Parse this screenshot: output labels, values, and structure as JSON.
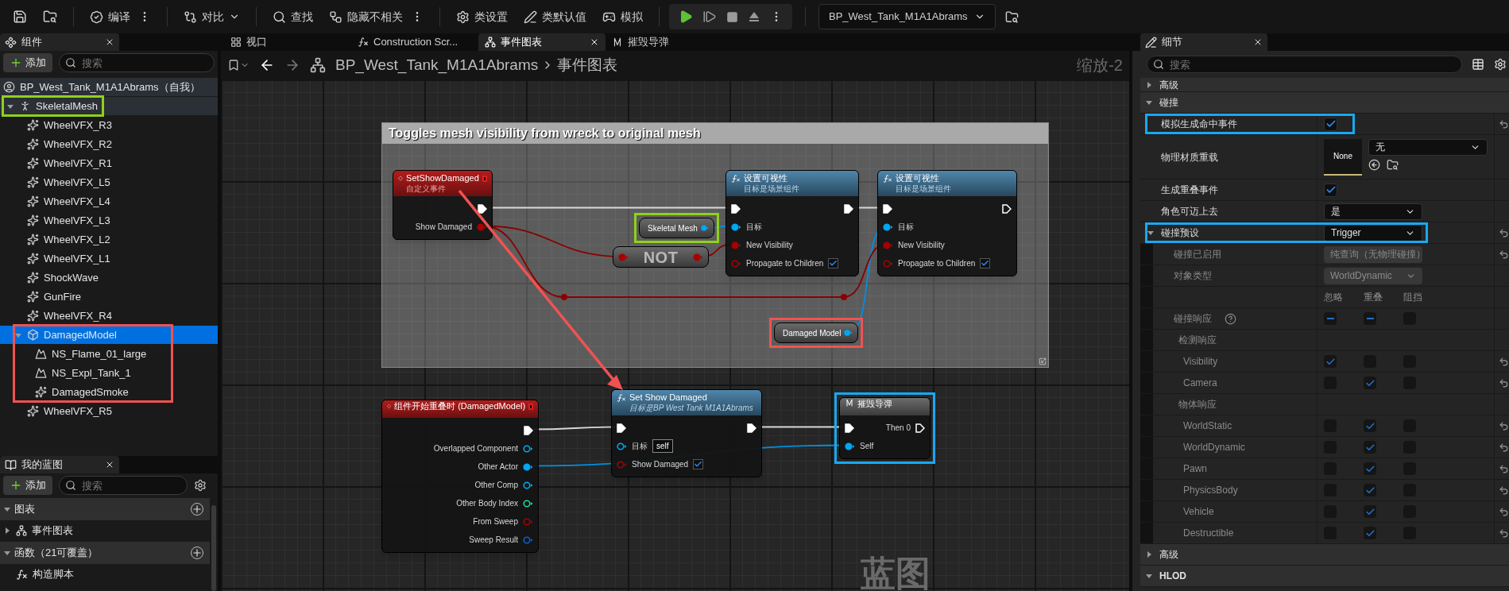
{
  "toolbar": {
    "buttons": [
      {
        "label": "编译",
        "kind": "menu",
        "divider_before": true
      },
      {
        "label": "对比",
        "kind": "dropdown",
        "divider_before": true
      },
      {
        "label": "查找",
        "kind": "plain",
        "divider_before": true
      },
      {
        "label": "隐藏不相关",
        "kind": "menu",
        "divider_before": false
      },
      {
        "label": "类设置",
        "kind": "plain",
        "divider_before": true
      },
      {
        "label": "类默认值",
        "kind": "plain",
        "divider_before": false
      },
      {
        "label": "模拟",
        "kind": "plain",
        "divider_before": false
      }
    ],
    "blueprint_selector": "BP_West_Tank_M1A1Abrams"
  },
  "components": {
    "title": "组件",
    "add_label": "添加",
    "search_placeholder": "搜索",
    "tree": [
      {
        "label": "BP_West_Tank_M1A1Abrams（自我）",
        "kind": "actor",
        "selected": false,
        "children": [
          {
            "label": "SkeletalMesh",
            "kind": "skeletal",
            "selected": false,
            "expanded": true,
            "highlight": {
              "color": "#8fd11b"
            },
            "children": [
              {
                "label": "WheelVFX_R3",
                "kind": "vfx",
                "selected": false
              },
              {
                "label": "WheelVFX_R2",
                "kind": "vfx",
                "selected": false
              },
              {
                "label": "WheelVFX_R1",
                "kind": "vfx",
                "selected": false
              },
              {
                "label": "WheelVFX_L5",
                "kind": "vfx",
                "selected": false
              },
              {
                "label": "WheelVFX_L4",
                "kind": "vfx",
                "selected": false
              },
              {
                "label": "WheelVFX_L3",
                "kind": "vfx",
                "selected": false
              },
              {
                "label": "WheelVFX_L2",
                "kind": "vfx",
                "selected": false
              },
              {
                "label": "WheelVFX_L1",
                "kind": "vfx",
                "selected": false
              },
              {
                "label": "ShockWave",
                "kind": "vfx",
                "selected": false
              },
              {
                "label": "GunFire",
                "kind": "vfx",
                "selected": false
              },
              {
                "label": "WheelVFX_R4",
                "kind": "vfx",
                "selected": false
              },
              {
                "label": "DamagedModel",
                "kind": "mesh",
                "selected": true,
                "expanded": true,
                "group_highlight": {
                  "color": "#f05252"
                },
                "children": [
                  {
                    "label": "NS_Flame_01_large",
                    "kind": "emitter",
                    "selected": false
                  },
                  {
                    "label": "NS_Expl_Tank_1",
                    "kind": "emitter",
                    "selected": false
                  },
                  {
                    "label": "DamagedSmoke",
                    "kind": "vfx",
                    "selected": false
                  }
                ]
              },
              {
                "label": "WheelVFX_R5",
                "kind": "vfx",
                "selected": false
              }
            ]
          }
        ]
      }
    ]
  },
  "my_blueprint": {
    "title": "我的蓝图",
    "add_label": "添加",
    "search_placeholder": "搜索",
    "sections": [
      {
        "label": "图表",
        "expanded": true,
        "items": [
          {
            "label": "事件图表",
            "kind": "graph",
            "expanded": false
          }
        ]
      },
      {
        "label": "函数（21可覆盖）",
        "expanded": true,
        "items": [
          {
            "label": "构造脚本",
            "kind": "function"
          }
        ]
      }
    ]
  },
  "editor_tabs": [
    {
      "label": "视口",
      "kind": "viewport",
      "selected": false
    },
    {
      "label": "Construction Scr...",
      "kind": "function",
      "selected": false
    },
    {
      "label": "事件图表",
      "kind": "graph",
      "selected": true
    },
    {
      "label": "摧毁导弹",
      "kind": "macro",
      "selected": false
    }
  ],
  "breadcrumb": {
    "blueprint": "BP_West_Tank_M1A1Abrams",
    "graph": "事件图表"
  },
  "graph": {
    "comment": "Toggles mesh visibility from wreck to original mesh",
    "zoom_label": "缩放-2",
    "watermark": "蓝图",
    "nodes": [
      {
        "kind": "event",
        "title": "SetShowDamaged",
        "subtitle": "自定义事件",
        "rows": [
          {
            "right": {
              "kind": "exec",
              "linked": true
            }
          },
          {
            "right": {
              "kind": "bool",
              "label": "Show Damaged",
              "linked": true
            }
          }
        ]
      },
      {
        "kind": "variable",
        "title": "Skeletal Mesh",
        "highlight": {
          "color": "#8fd11b"
        },
        "rows": [
          {
            "right": {
              "kind": "object",
              "linked": true
            }
          }
        ]
      },
      {
        "kind": "not",
        "title": "NOT",
        "rows": [
          {
            "left": {
              "kind": "bool",
              "linked": true
            },
            "right": {
              "kind": "bool",
              "linked": true
            }
          }
        ]
      },
      {
        "kind": "function",
        "title": "设置可视性",
        "subtitle": "目标是场景组件",
        "rows": [
          {
            "left": {
              "kind": "exec",
              "linked": true
            },
            "right": {
              "kind": "exec",
              "linked": true
            }
          },
          {
            "left": {
              "kind": "object",
              "label": "目标",
              "linked": true
            }
          },
          {
            "left": {
              "kind": "bool",
              "label": "New Visibility",
              "linked": true
            }
          },
          {
            "left": {
              "kind": "bool",
              "label": "Propagate to Children",
              "linked": false,
              "checked": true
            }
          }
        ]
      },
      {
        "kind": "function",
        "title": "设置可视性",
        "subtitle": "目标是场景组件",
        "rows": [
          {
            "left": {
              "kind": "exec",
              "linked": true
            },
            "right": {
              "kind": "exec",
              "linked": false
            }
          },
          {
            "left": {
              "kind": "object",
              "label": "目标",
              "linked": true
            }
          },
          {
            "left": {
              "kind": "bool",
              "label": "New Visibility",
              "linked": true
            }
          },
          {
            "left": {
              "kind": "bool",
              "label": "Propagate to Children",
              "linked": false,
              "checked": true
            }
          }
        ]
      },
      {
        "kind": "variable",
        "title": "Damaged Model",
        "highlight": {
          "color": "#f05252"
        },
        "rows": [
          {
            "right": {
              "kind": "object",
              "linked": true
            }
          }
        ]
      },
      {
        "kind": "event",
        "title": "组件开始重叠时 (DamagedModel)",
        "rows": [
          {
            "right": {
              "kind": "exec",
              "linked": true
            }
          },
          {
            "right": {
              "kind": "object",
              "label": "Overlapped Component",
              "linked": false
            }
          },
          {
            "right": {
              "kind": "object",
              "label": "Other Actor",
              "linked": true
            }
          },
          {
            "right": {
              "kind": "object",
              "label": "Other Comp",
              "linked": false
            }
          },
          {
            "right": {
              "kind": "int",
              "label": "Other Body Index",
              "linked": false
            }
          },
          {
            "right": {
              "kind": "bool",
              "label": "From Sweep",
              "linked": false
            }
          },
          {
            "right": {
              "kind": "struct",
              "label": "Sweep Result",
              "linked": false
            }
          }
        ]
      },
      {
        "kind": "function",
        "title": "Set Show Damaged",
        "subtitle": "目标是BP West Tank M1A1Abrams",
        "rows": [
          {
            "left": {
              "kind": "exec",
              "linked": true
            },
            "right": {
              "kind": "exec",
              "linked": true
            }
          },
          {
            "left": {
              "kind": "object",
              "label": "目标",
              "linked": false,
              "value": "self"
            }
          },
          {
            "left": {
              "kind": "bool",
              "label": "Show Damaged",
              "linked": false,
              "checked": true
            }
          }
        ]
      },
      {
        "kind": "macro",
        "title": "摧毁导弹",
        "highlight": {
          "color": "#19a8f0"
        },
        "rows": [
          {
            "left": {
              "kind": "exec",
              "linked": true
            },
            "right": {
              "kind": "exec",
              "label": "Then 0",
              "linked": false
            }
          },
          {
            "left": {
              "kind": "object",
              "label": "Self",
              "linked": true
            }
          }
        ]
      }
    ]
  },
  "details": {
    "title": "细节",
    "search_placeholder": "搜索",
    "sections": [
      {
        "label": "高级",
        "expanded": false
      },
      {
        "label": "碰撞",
        "expanded": true,
        "rows": [
          {
            "kind": "checkbox",
            "label": "模拟生成命中事件",
            "checked": true,
            "resettable": true,
            "highlight": {
              "color": "#19a8f0"
            }
          },
          {
            "kind": "asset",
            "label": "物理材质重载",
            "thumbnail": "None",
            "value": "无"
          },
          {
            "kind": "checkbox",
            "label": "生成重叠事件",
            "checked": true
          },
          {
            "kind": "dropdown",
            "label": "角色可迈上去",
            "value": "是"
          },
          {
            "kind": "dropdown",
            "label": "碰撞预设",
            "value": "Trigger",
            "expanded": true,
            "resettable": true,
            "highlight": {
              "color": "#19a8f0"
            },
            "children": [
              {
                "kind": "dropdown",
                "label": "碰撞已启用",
                "value": "纯查询（无物理碰撞）",
                "disabled": true,
                "resettable": true
              },
              {
                "kind": "dropdown",
                "label": "对象类型",
                "value": "WorldDynamic",
                "disabled": true
              },
              {
                "kind": "columns",
                "columns": [
                  "忽略",
                  "重叠",
                  "阻挡"
                ]
              },
              {
                "kind": "responses",
                "label": "碰撞响应",
                "help": true,
                "disabled": true,
                "responses": [
                  {
                    "mixed": true
                  },
                  {
                    "mixed": true
                  },
                  {
                    "checked": false
                  }
                ]
              },
              {
                "kind": "group",
                "label": "检测响应",
                "disabled": true
              },
              {
                "kind": "responses",
                "label": "Visibility",
                "disabled": true,
                "resettable": true,
                "responses": [
                  {
                    "checked": true
                  },
                  {
                    "checked": false
                  },
                  {
                    "checked": false
                  }
                ]
              },
              {
                "kind": "responses",
                "label": "Camera",
                "disabled": true,
                "resettable": true,
                "responses": [
                  {
                    "checked": false
                  },
                  {
                    "checked": true
                  },
                  {
                    "checked": false
                  }
                ]
              },
              {
                "kind": "group",
                "label": "物体响应",
                "disabled": true
              },
              {
                "kind": "responses",
                "label": "WorldStatic",
                "disabled": true,
                "resettable": true,
                "responses": [
                  {
                    "checked": false
                  },
                  {
                    "checked": true
                  },
                  {
                    "checked": false
                  }
                ]
              },
              {
                "kind": "responses",
                "label": "WorldDynamic",
                "disabled": true,
                "resettable": true,
                "responses": [
                  {
                    "checked": false
                  },
                  {
                    "checked": true
                  },
                  {
                    "checked": false
                  }
                ]
              },
              {
                "kind": "responses",
                "label": "Pawn",
                "disabled": true,
                "resettable": true,
                "responses": [
                  {
                    "checked": false
                  },
                  {
                    "checked": true
                  },
                  {
                    "checked": false
                  }
                ]
              },
              {
                "kind": "responses",
                "label": "PhysicsBody",
                "disabled": true,
                "resettable": true,
                "responses": [
                  {
                    "checked": false
                  },
                  {
                    "checked": true
                  },
                  {
                    "checked": false
                  }
                ]
              },
              {
                "kind": "responses",
                "label": "Vehicle",
                "disabled": true,
                "resettable": true,
                "responses": [
                  {
                    "checked": false
                  },
                  {
                    "checked": true
                  },
                  {
                    "checked": false
                  }
                ]
              },
              {
                "kind": "responses",
                "label": "Destructible",
                "disabled": true,
                "resettable": true,
                "responses": [
                  {
                    "checked": false
                  },
                  {
                    "checked": true
                  },
                  {
                    "checked": false
                  }
                ]
              }
            ]
          }
        ]
      },
      {
        "label": "高级",
        "expanded": false
      },
      {
        "label": "HLOD",
        "expanded": true
      }
    ]
  }
}
